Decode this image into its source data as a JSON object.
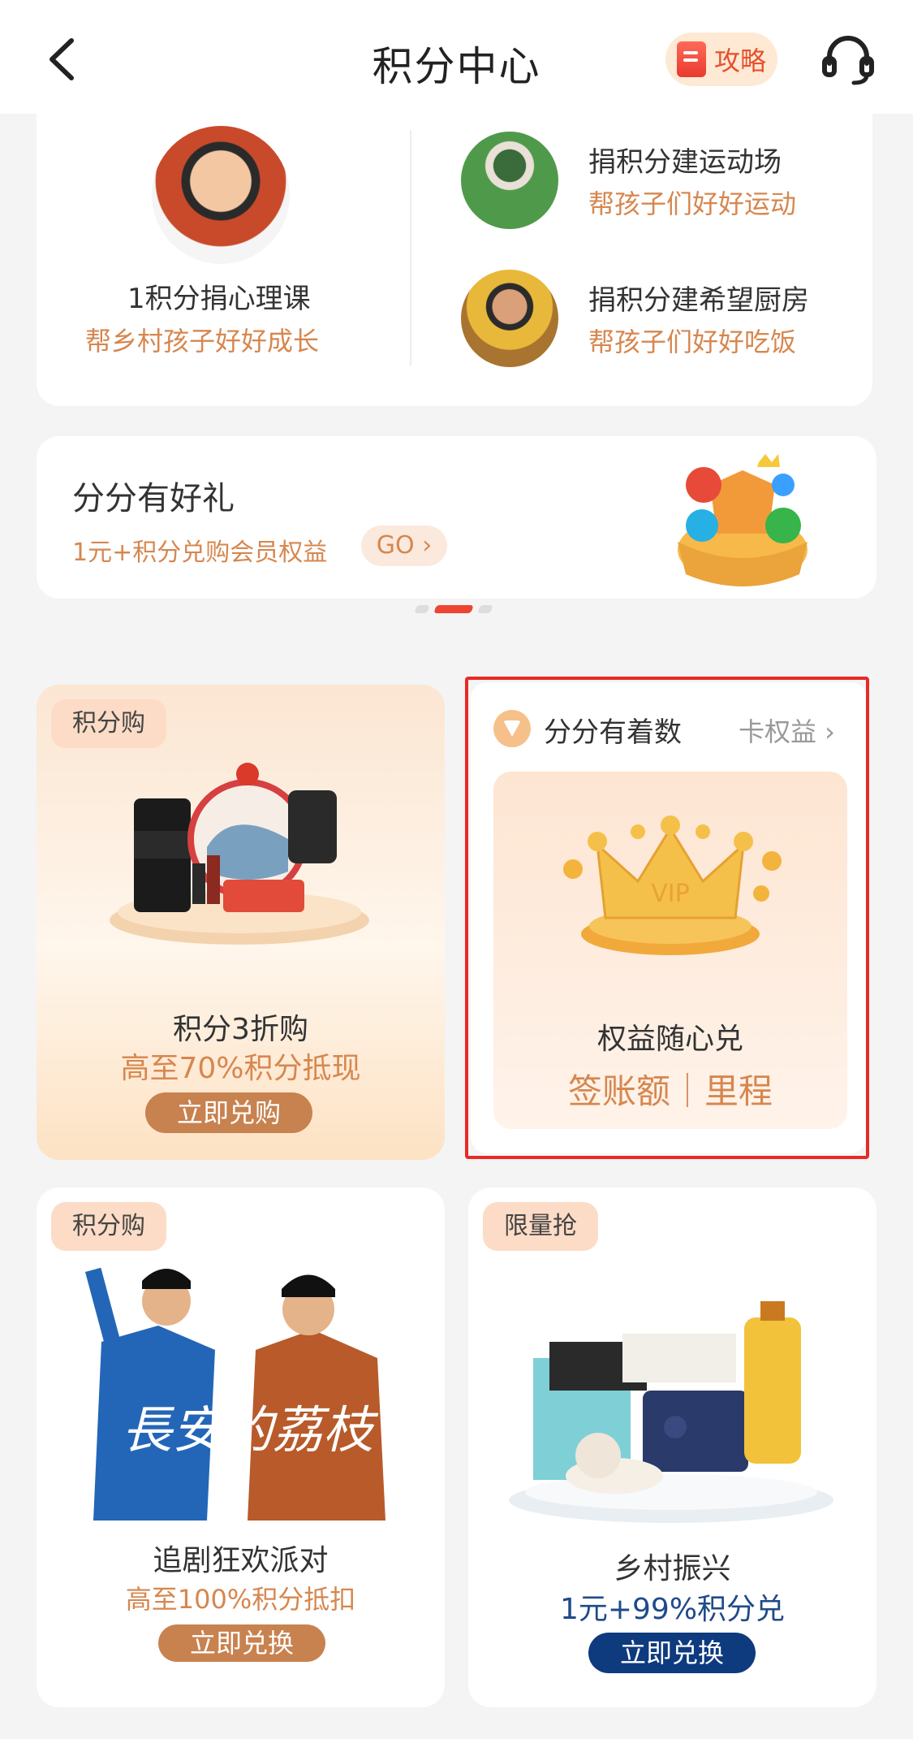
{
  "header": {
    "title": "积分中心",
    "guide_label": "攻略",
    "icons": [
      "back-arrow-icon",
      "book-icon",
      "headset-icon"
    ]
  },
  "charity": {
    "left": {
      "title": "1积分捐心理课",
      "subtitle": "帮乡村孩子好好成长"
    },
    "right": [
      {
        "title": "捐积分建运动场",
        "subtitle": "帮孩子们好好运动"
      },
      {
        "title": "捐积分建希望厨房",
        "subtitle": "帮孩子们好好吃饭"
      }
    ]
  },
  "gift_banner": {
    "title": "分分有好礼",
    "subtitle": "1元+积分兑购会员权益",
    "go_label": "GO ›",
    "page_indicator": {
      "pages": 3,
      "active": 2
    }
  },
  "promo_points_buy": {
    "tag": "积分购",
    "title": "积分3折购",
    "subtitle": "高至70%积分抵现",
    "button": "立即兑购"
  },
  "promo_rights": {
    "title": "分分有着数",
    "link": "卡权益 ›",
    "line1": "权益随心兑",
    "line2": "签账额｜里程",
    "crown_text": "VIP"
  },
  "promo_drama": {
    "tag": "积分购",
    "art_text": "長安的荔枝",
    "title": "追剧狂欢派对",
    "subtitle": "高至100%积分抵扣",
    "button": "立即兑换"
  },
  "promo_rural": {
    "tag": "限量抢",
    "title": "乡村振兴",
    "subtitle": "1元+99%积分兑",
    "button": "立即兑换"
  },
  "colors": {
    "accent_orange": "#d6874f",
    "highlight_red": "#e82a26",
    "navy_button": "#0e3a7e",
    "brown_button": "#c8824f"
  }
}
